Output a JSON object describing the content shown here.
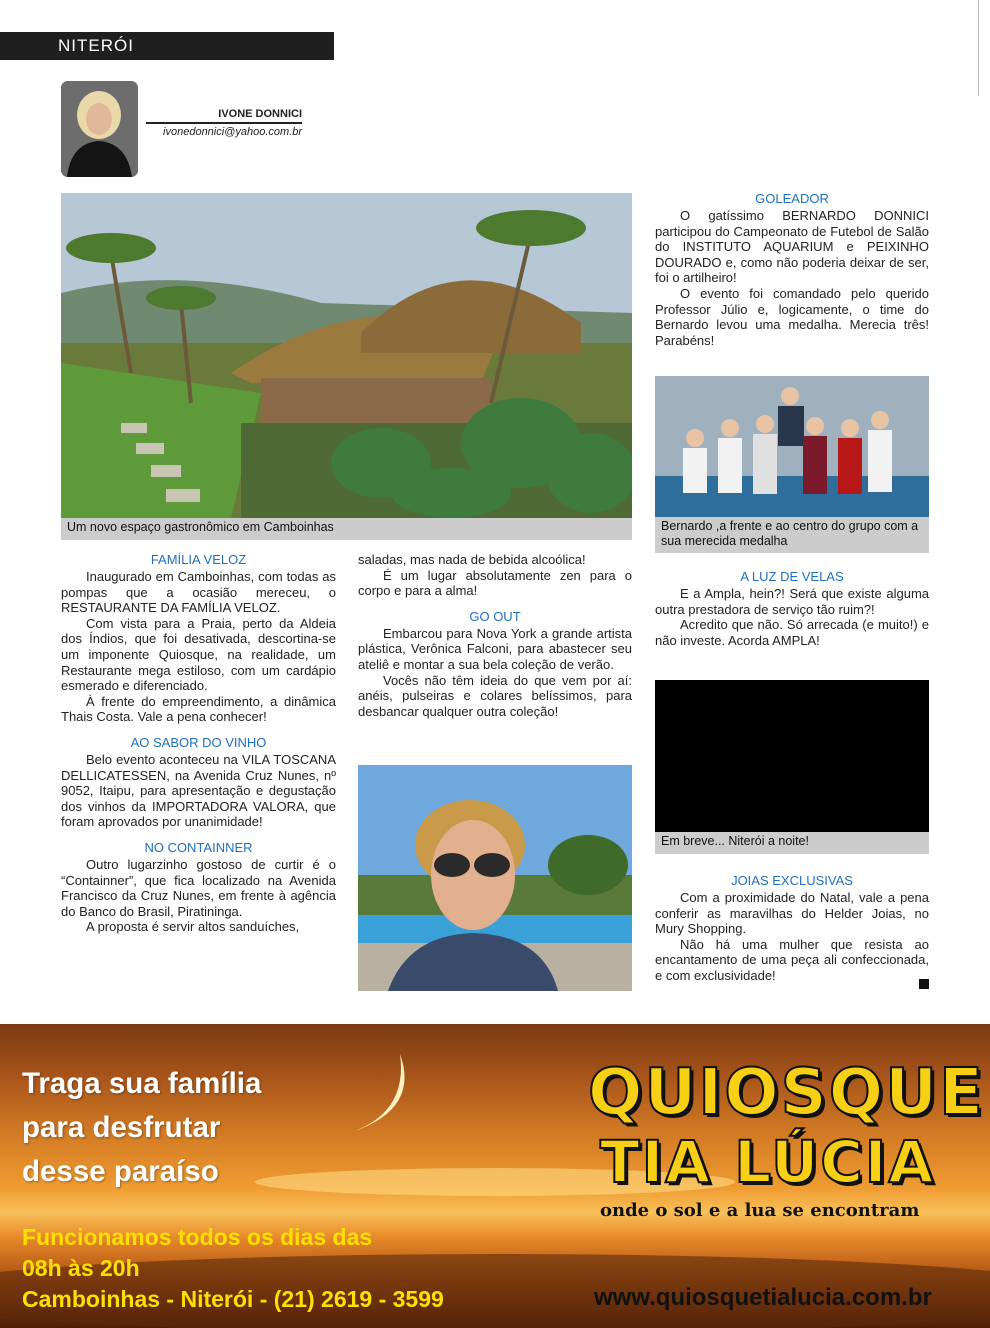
{
  "header": {
    "section": "NITERÓI"
  },
  "author": {
    "name": "IVONE DONNICI",
    "email": "ivonedonnici@yahoo.com.br"
  },
  "captions": {
    "main": "Um novo espaço gastronômico em Camboinhas",
    "group": "Bernardo ,a frente e ao centro do grupo com a sua merecida medalha",
    "night": "Em breve... Niterói a noite!"
  },
  "col1": {
    "h1": "FAMÍLIA VELOZ",
    "p1": "Inaugurado em Camboinhas, com todas as pompas que a ocasião mereceu, o RESTAURANTE DA FAMÍLIA VELOZ.",
    "p2": "Com vista para a Praia, perto da Aldeia dos Índios, que foi desativada, descortina-se um imponente Quiosque, na realidade, um Restaurante mega estiloso, com um cardápio esmerado e diferenciado.",
    "p3": "À frente do empreendimento, a dinâmica Thais Costa. Vale a pena conhecer!",
    "h2": "AO SABOR DO VINHO",
    "p4": "Belo evento aconteceu na VILA TOSCANA DELLICATESSEN, na Avenida Cruz Nunes, nº 9052, Itaipu, para apresentação e degustação dos vinhos da IMPORTADORA VALORA, que foram aprovados por unanimidade!",
    "h3": "NO CONTAINNER",
    "p5": "Outro lugarzinho gostoso de curtir é o “Containner”, que fica localizado na Avenida Francisco da Cruz Nunes, em frente à agência do Banco do Brasil, Piratininga.",
    "p6": "A proposta é servir altos sanduíches,"
  },
  "col2": {
    "p0": "saladas, mas nada de bebida alcoólica!",
    "p1": "É um lugar absolutamente zen para o corpo e para a alma!",
    "h1": "GO OUT",
    "p2": "Embarcou para Nova York a grande artista plástica, Verônica Falconi, para abastecer seu ateliê e montar a sua bela coleção de verão.",
    "p3": "Vocês não têm ideia do que vem por aí: anéis, pulseiras e colares belíssimos, para desbancar qualquer outra coleção!"
  },
  "col3": {
    "h1": "GOLEADOR",
    "p1": "O gatíssimo BERNARDO DONNICI participou do Campeonato de Futebol de Salão do INSTITUTO AQUARIUM e PEIXINHO DOURADO e, como não poderia deixar de ser, foi o artilheiro!",
    "p2": "O evento foi comandado pelo querido Professor Júlio e, logicamente, o time do Bernardo levou uma medalha. Merecia três! Parabéns!",
    "h2": "A LUZ DE VELAS",
    "p3": "E a Ampla, hein?! Será que existe alguma outra prestadora de serviço tão ruim?!",
    "p4": "Acredito que não. Só arrecada (e muito!) e não investe. Acorda AMPLA!",
    "h3": "JOIAS EXCLUSIVAS",
    "p5": "Com a proximidade do Natal, vale a pena conferir as maravilhas do Helder Joias, no Mury Shopping.",
    "p6": "Não há uma mulher que resista ao encantamento de uma peça ali confeccionada, e com exclusividade!"
  },
  "ad": {
    "line1": "Traga sua família",
    "line2": "para desfrutar",
    "line3": "desse paraíso",
    "hours1": "Funcionamos todos os dias das",
    "hours2": "08h às 20h",
    "hours3": "Camboinhas - Niterói - (21) 2619 - 3599",
    "logo1": "QUIOSQUE",
    "logo2": "TIA LÚCIA",
    "tagline": "onde o sol e a lua se encontram",
    "url": "www.quiosquetialucia.com.br"
  }
}
